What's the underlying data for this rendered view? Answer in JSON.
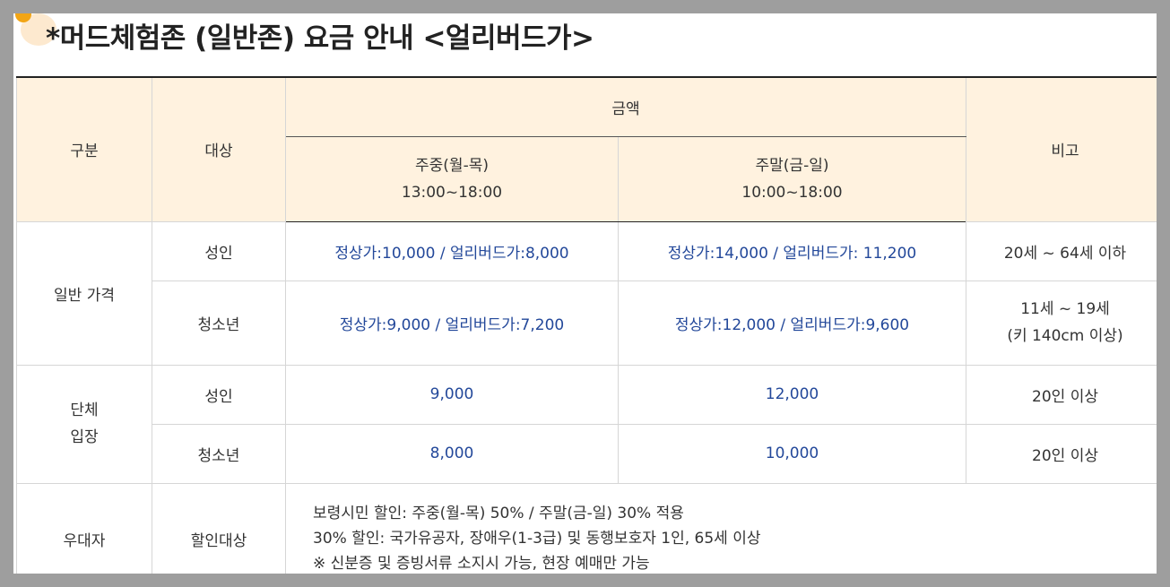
{
  "title": "*머드체험존 (일반존) 요금 안내 <얼리버드가>",
  "colors": {
    "header_bg": "#fff2df",
    "price_text": "#23489a",
    "accent_dot": "#f2a515"
  },
  "header": {
    "category": "구분",
    "target": "대상",
    "amount": "금액",
    "note": "비고",
    "weekday_label": "주중(월-목)",
    "weekday_time": "13:00~18:00",
    "weekend_label": "주말(금-일)",
    "weekend_time": "10:00~18:00"
  },
  "general": {
    "category": "일반 가격",
    "adult": {
      "target": "성인",
      "weekday": "정상가:10,000 / 얼리버드가:8,000",
      "weekend": "정상가:14,000 / 얼리버드가: 11,200",
      "note": "20세 ~ 64세 이하"
    },
    "youth": {
      "target": "청소년",
      "weekday": "정상가:9,000 / 얼리버드가:7,200",
      "weekend": "정상가:12,000 / 얼리버드가:9,600",
      "note_line1": "11세 ~ 19세",
      "note_line2": "(키 140cm 이상)"
    }
  },
  "group": {
    "category_line1": "단체",
    "category_line2": "입장",
    "adult": {
      "target": "성인",
      "weekday": "9,000",
      "weekend": "12,000",
      "note": "20인 이상"
    },
    "youth": {
      "target": "청소년",
      "weekday": "8,000",
      "weekend": "10,000",
      "note": "20인 이상"
    }
  },
  "discount": {
    "category": "우대자",
    "target": "할인대상",
    "line1": "보령시민 할인: 주중(월-목) 50% / 주말(금-일) 30% 적용",
    "line2": "30% 할인: 국가유공자, 장애우(1-3급) 및 동행보호자 1인, 65세 이상",
    "line3": "※ 신분증 및 증빙서류 소지시 가능, 현장 예매만 가능"
  }
}
